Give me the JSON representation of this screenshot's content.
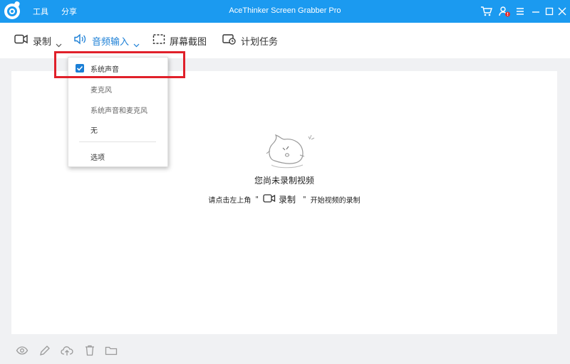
{
  "titlebar": {
    "title": "AceThinker Screen Grabber Pro",
    "menu": [
      "工具",
      "分享"
    ],
    "icons": [
      "cart-icon",
      "user-alert-icon",
      "menu-icon",
      "minimize-icon",
      "maximize-icon",
      "close-icon"
    ],
    "color": "#1b9af0"
  },
  "toolbar": {
    "record_label": "录制",
    "audio_label": "音频输入",
    "screenshot_label": "屏幕截图",
    "schedule_label": "计划任务",
    "accent": "#1b7fd6"
  },
  "dropdown": {
    "items": [
      {
        "label": "系统声音",
        "checked": true
      },
      {
        "label": "麦克风",
        "checked": false
      },
      {
        "label": "系统声音和麦克风",
        "checked": false
      },
      {
        "label": "无",
        "checked": false
      }
    ],
    "options_label": "选项",
    "highlight_color": "#e0202a"
  },
  "empty_state": {
    "title": "您尚未录制视频",
    "hint_prefix": "请点击左上角",
    "quote_open": "\"",
    "record_word": "录制",
    "quote_close": "\"",
    "hint_suffix": "开始视频的录制"
  },
  "bottom_icons": [
    "eye-icon",
    "edit-icon",
    "cloud-upload-icon",
    "trash-icon",
    "folder-icon"
  ]
}
